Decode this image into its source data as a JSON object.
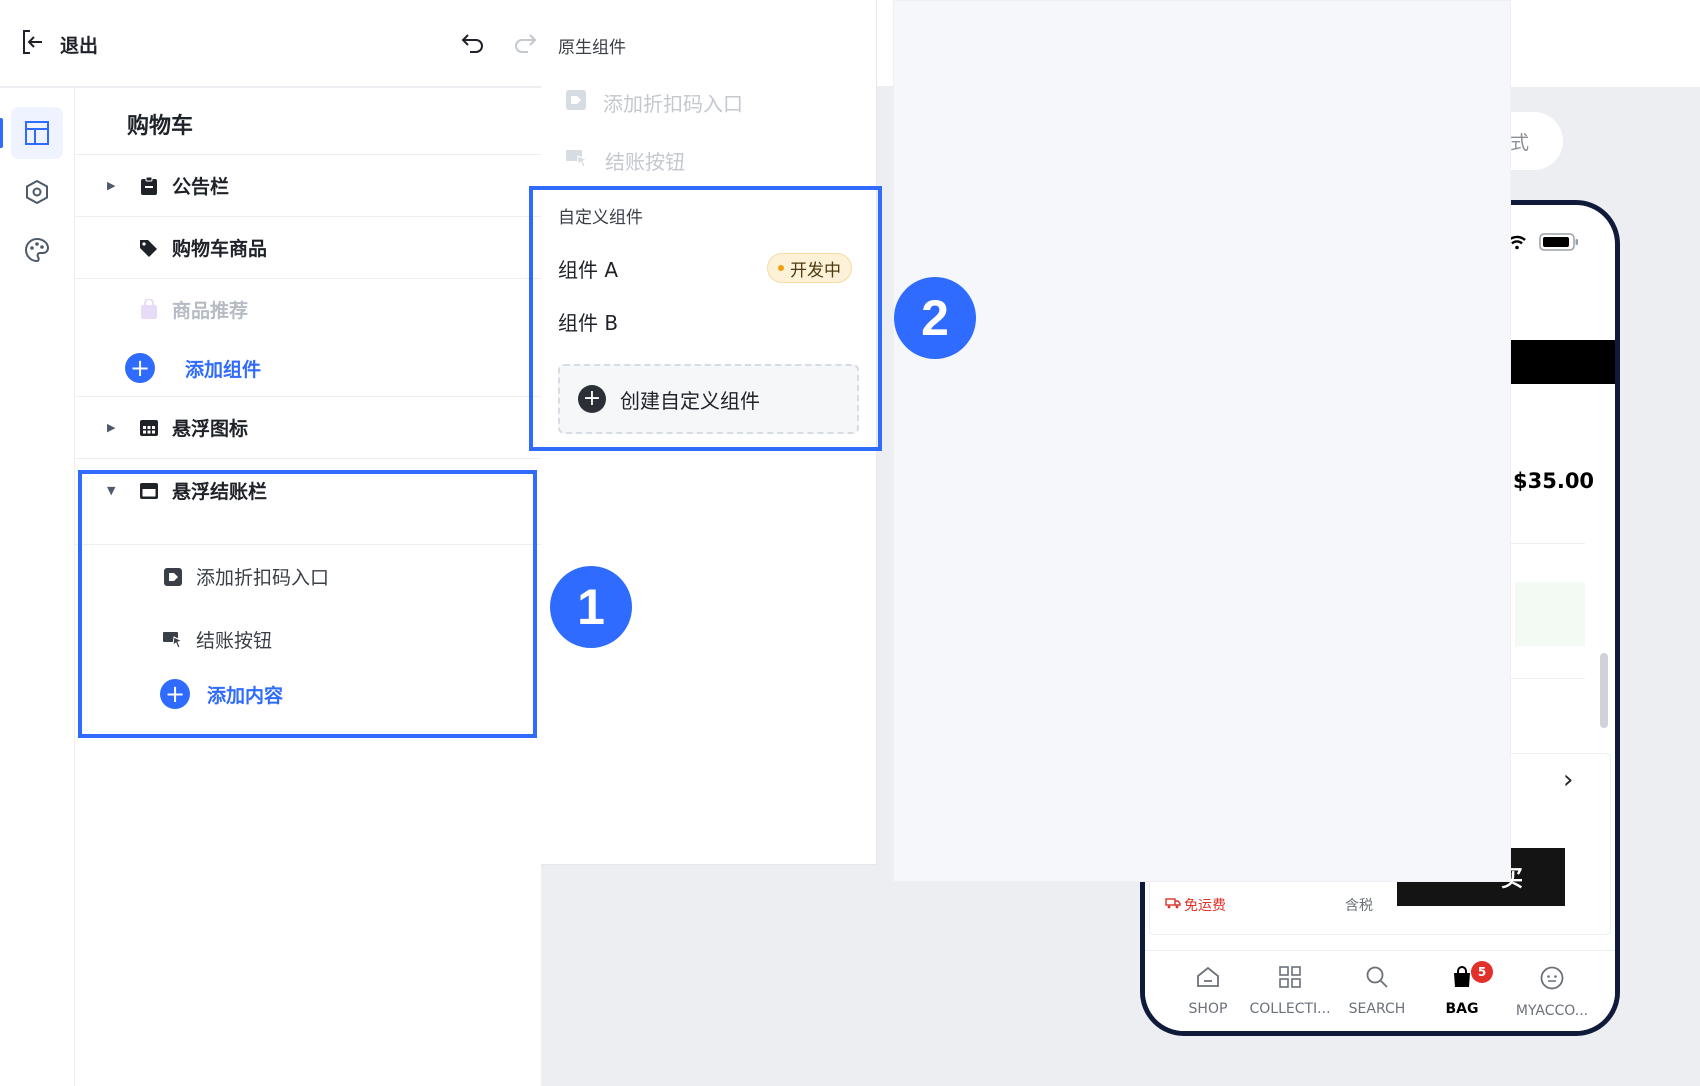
{
  "header": {
    "exit_label": "退出"
  },
  "tree": {
    "title": "购物车",
    "items": [
      {
        "label": "公告栏"
      },
      {
        "label": "购物车商品"
      },
      {
        "label": "商品推荐"
      },
      {
        "label": "添加组件"
      },
      {
        "label": "悬浮图标"
      },
      {
        "label": "悬浮结账栏"
      },
      {
        "label": "添加折扣码入口"
      },
      {
        "label": "结账按钮"
      },
      {
        "label": "添加内容"
      }
    ]
  },
  "picker": {
    "native_heading": "原生组件",
    "native_items": [
      {
        "label": "添加折扣码入口"
      },
      {
        "label": "结账按钮"
      }
    ],
    "custom_heading": "自定义组件",
    "custom_items": [
      {
        "label": "组件 A",
        "badge": "开发中"
      },
      {
        "label": "组件 B"
      }
    ],
    "create_label": "创建自定义组件"
  },
  "canvas": {
    "style_pill": "式"
  },
  "phone": {
    "price": "$35.00",
    "buy_label": "买",
    "free_shipping": "免运费",
    "tax_label": "含税",
    "tabs": [
      {
        "label": "SHOP"
      },
      {
        "label": "COLLECTI..."
      },
      {
        "label": "SEARCH"
      },
      {
        "label": "BAG",
        "badge": "5"
      },
      {
        "label": "MYACCO..."
      }
    ]
  },
  "annotations": {
    "badge_1": "1",
    "badge_2": "2"
  },
  "colors": {
    "accent": "#2f6bff",
    "badge_red": "#e0322b",
    "dev_badge_bg": "#fdf1d8"
  }
}
